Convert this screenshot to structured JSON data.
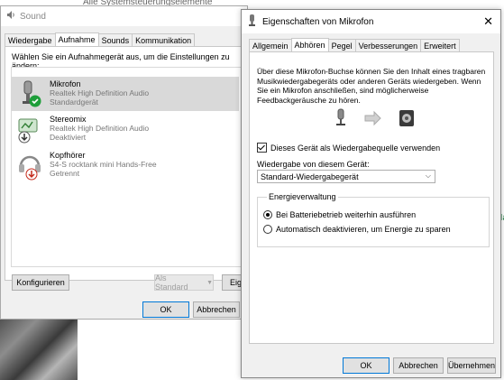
{
  "background": {
    "title_fragment": "Alle Systemsteuerungselemente",
    "sidebar_fragments": [
      "rt",
      "on",
      "k",
      "Ma",
      "e",
      "e",
      "e"
    ]
  },
  "sound_window": {
    "title": "Sound",
    "tabs": [
      {
        "label": "Wiedergabe",
        "active": false
      },
      {
        "label": "Aufnahme",
        "active": true
      },
      {
        "label": "Sounds",
        "active": false
      },
      {
        "label": "Kommunikation",
        "active": false
      }
    ],
    "instruction": "Wählen Sie ein Aufnahmegerät aus, um die Einstellungen zu ändern:",
    "devices": [
      {
        "name": "Mikrofon",
        "driver": "Realtek High Definition Audio",
        "status": "Standardgerät",
        "icon": "microphone-icon",
        "badge": "check-badge-icon",
        "selected": true
      },
      {
        "name": "Stereomix",
        "driver": "Realtek High Definition Audio",
        "status": "Deaktiviert",
        "icon": "stereomix-icon",
        "badge": "down-arrow-badge-icon",
        "selected": false
      },
      {
        "name": "Kopfhörer",
        "driver": "S4-S rocktank mini Hands-Free",
        "status": "Getrennt",
        "icon": "headset-icon",
        "badge": "red-down-badge-icon",
        "selected": false
      }
    ],
    "configure_button": "Konfigurieren",
    "set_default_button": "Als Standard",
    "properties_button_partial": "Eige",
    "ok_button": "OK",
    "cancel_button": "Abbrechen"
  },
  "props_dialog": {
    "title": "Eigenschaften von Mikrofon",
    "close_glyph": "✕",
    "tabs": [
      {
        "label": "Allgemein",
        "active": false
      },
      {
        "label": "Abhören",
        "active": true
      },
      {
        "label": "Pegel",
        "active": false
      },
      {
        "label": "Verbesserungen",
        "active": false
      },
      {
        "label": "Erweitert",
        "active": false
      }
    ],
    "description": "Über diese Mikrofon-Buchse können Sie den Inhalt eines tragbaren Musikwiedergabegeräts oder anderen Geräts wiedergeben. Wenn Sie ein Mikrofon anschließen, sind möglicherweise Feedbackgeräusche zu hören.",
    "listen_checkbox": {
      "label": "Dieses Gerät als Wiedergabequelle verwenden",
      "checked": true
    },
    "playback_label": "Wiedergabe von diesem Gerät:",
    "playback_value": "Standard-Wiedergabegerät",
    "power_group_title": "Energieverwaltung",
    "power_options": [
      {
        "label": "Bei Batteriebetrieb weiterhin ausführen",
        "selected": true
      },
      {
        "label": "Automatisch deaktivieren, um Energie zu sparen",
        "selected": false
      }
    ],
    "ok_button": "OK",
    "cancel_button": "Abbrechen",
    "apply_button": "Übernehmen"
  },
  "colors": {
    "accent": "#0078d7",
    "selection": "#d9d9d9",
    "check_green": "#1e9e3a",
    "badge_red": "#c42b1c"
  }
}
